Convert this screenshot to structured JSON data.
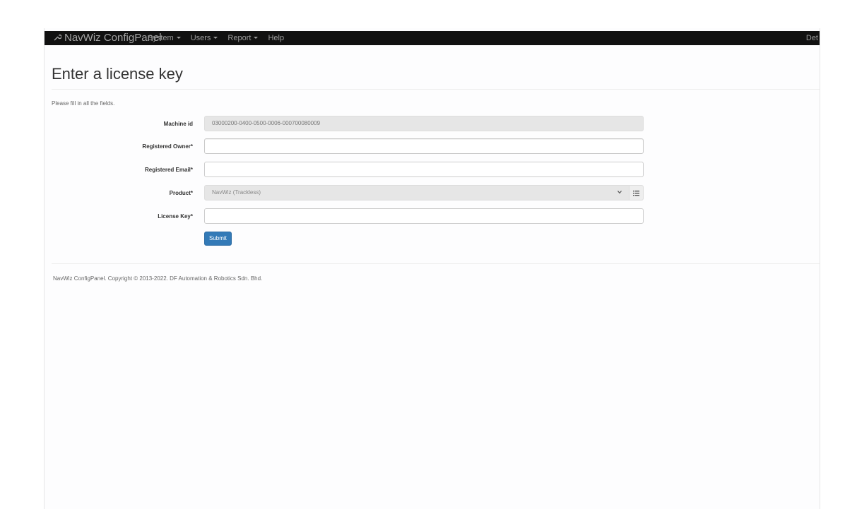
{
  "navbar": {
    "brand": "NavWiz ConfigPanel",
    "menu": [
      {
        "label": "System",
        "has_dropdown": true
      },
      {
        "label": "Users",
        "has_dropdown": true
      },
      {
        "label": "Report",
        "has_dropdown": true
      },
      {
        "label": "Help",
        "has_dropdown": false
      }
    ],
    "right_label": "Det"
  },
  "page": {
    "title": "Enter a license key",
    "instructions": "Please fill in all the fields."
  },
  "form": {
    "machine_id": {
      "label": "Machine id",
      "value": "03000200-0400-0500-0006-000700080009"
    },
    "registered_owner": {
      "label": "Registered Owner*",
      "value": ""
    },
    "registered_email": {
      "label": "Registered Email*",
      "value": ""
    },
    "product": {
      "label": "Product*",
      "selected": "NavWiz (Trackless)"
    },
    "license_key": {
      "label": "License Key*",
      "value": ""
    },
    "submit_label": "Submit"
  },
  "footer": {
    "text": "NavWiz ConfigPanel. Copyright © 2013-2022. DF Automation & Robotics Sdn. Bhd."
  },
  "colors": {
    "navbar_bg": "#111111",
    "primary": "#337ab7",
    "readonly_bg": "#e6e6e6"
  },
  "icons": {
    "brand": "wrench-icon",
    "select_arrow": "chevron-down-icon",
    "addon": "list-icon"
  }
}
